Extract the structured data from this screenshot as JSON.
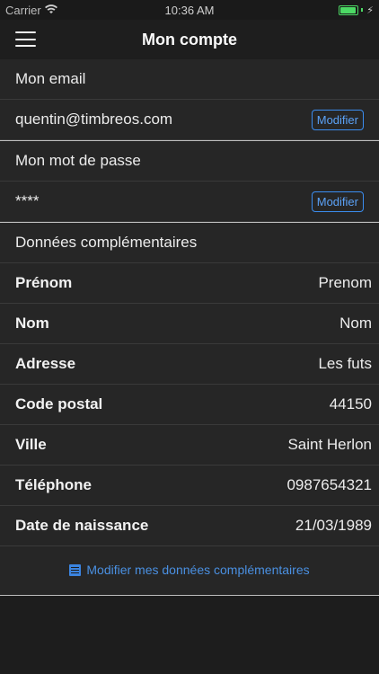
{
  "status_bar": {
    "carrier": "Carrier",
    "time": "10:36 AM"
  },
  "nav": {
    "title": "Mon compte"
  },
  "email_section": {
    "header": "Mon email",
    "value": "quentin@timbreos.com",
    "edit_label": "Modifier"
  },
  "password_section": {
    "header": "Mon mot de passe",
    "value": "****",
    "edit_label": "Modifier"
  },
  "extra_section": {
    "header": "Données complémentaires",
    "rows": [
      {
        "label": "Prénom",
        "value": "Prenom"
      },
      {
        "label": "Nom",
        "value": "Nom"
      },
      {
        "label": "Adresse",
        "value": "Les futs"
      },
      {
        "label": "Code postal",
        "value": "44150"
      },
      {
        "label": "Ville",
        "value": "Saint Herlon"
      },
      {
        "label": "Téléphone",
        "value": "0987654321"
      },
      {
        "label": "Date de naissance",
        "value": "21/03/1989"
      }
    ],
    "action_label": "Modifier mes données complémentaires"
  },
  "colors": {
    "accent": "#3b8df0",
    "background": "#262626",
    "battery": "#4cd964"
  }
}
